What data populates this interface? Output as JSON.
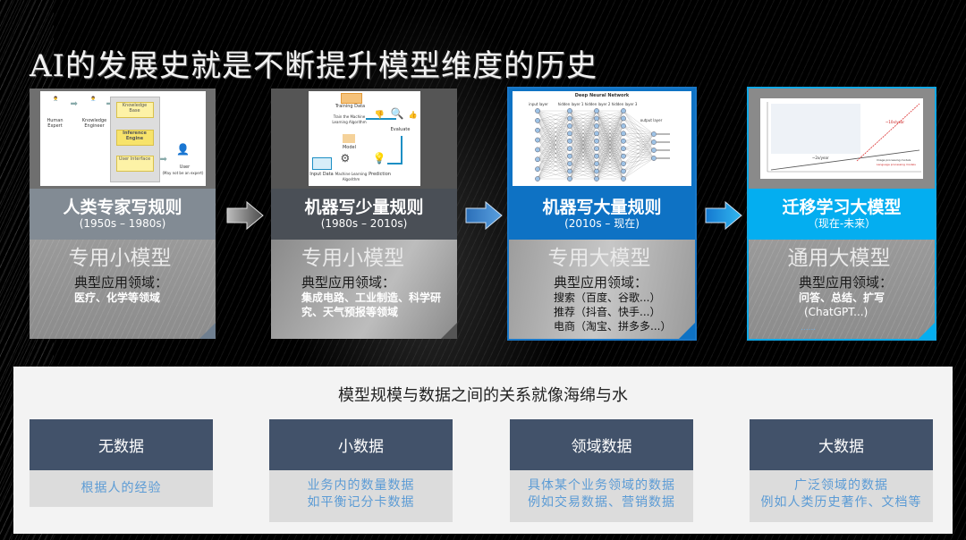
{
  "title": "AI的发展史就是不断提升模型维度的历史",
  "colors": {
    "stage1_band": "#828b94",
    "stage2_band": "#4a4f56",
    "stage3_band": "#0e72c4",
    "stage4_band": "#04aef0",
    "data_header": "#42526a",
    "data_text": "#5b9bd5"
  },
  "stages": [
    {
      "title": "人类专家写规则",
      "period": "(1950s – 1980s)",
      "model": "专用小模型",
      "domain_label": "典型应用领域：",
      "domains": [
        "医疗、化学等领域"
      ],
      "diagram": {
        "labels": [
          "Human Expert",
          "Knowledge Engineer",
          "Knowledge Base",
          "Inference Engine",
          "User Interface",
          "User",
          "(May not be an expert)"
        ]
      }
    },
    {
      "title": "机器写少量规则",
      "period": "(1980s – 2010s)",
      "model": "专用小模型",
      "domain_label": "典型应用领域：",
      "domains": [
        "集成电路、工业制造、科学研",
        "究、天气预报等领域"
      ],
      "diagram": {
        "labels": [
          "Training Data",
          "Train the Machine Learning Algorithm",
          "Model",
          "Input Data",
          "Machine Learning Algorithm",
          "Prediction",
          "Evaluate"
        ]
      }
    },
    {
      "title": "机器写大量规则",
      "period": "(2010s – 现在)",
      "model": "专用大模型",
      "domain_label": "典型应用领域：",
      "domains": [
        "搜索（百度、谷歌...）",
        "推荐（抖音、快手...）",
        "电商（淘宝、拼多多...）"
      ],
      "diagram": {
        "title": "Deep Neural Network",
        "labels": [
          "input layer",
          "hidden layer 1",
          "hidden layer 2",
          "hidden layer 3",
          "output layer"
        ]
      }
    },
    {
      "title": "迁移学习大模型",
      "period": "（现在-未来）",
      "model": "通用大模型",
      "domain_label": "典型应用领域：",
      "domains": [
        "问答、总结、扩写",
        "(ChatGPT...)",
        "......"
      ],
      "diagram": {
        "labels": [
          "~2x/year",
          "~10x/year",
          "Image processing models",
          "Language processing models"
        ]
      }
    }
  ],
  "data_section": {
    "title": "模型规模与数据之间的关系就像海绵与水",
    "items": [
      {
        "header": "无数据",
        "lines": [
          "根据人的经验"
        ]
      },
      {
        "header": "小数据",
        "lines": [
          "业务内的数量数据",
          "如平衡记分卡数据"
        ]
      },
      {
        "header": "领域数据",
        "lines": [
          "具体某个业务领域的数据",
          "例如交易数据、营销数据"
        ]
      },
      {
        "header": "大数据",
        "lines": [
          "广泛领域的数据",
          "例如人类历史著作、文档等"
        ]
      }
    ]
  }
}
